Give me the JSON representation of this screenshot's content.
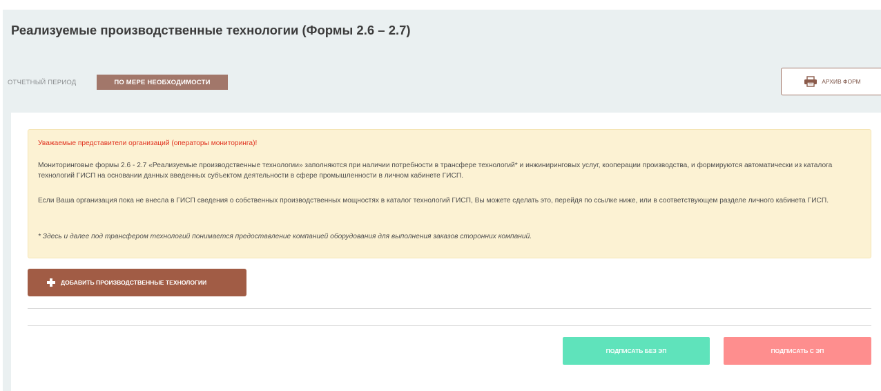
{
  "page": {
    "title": "Реализуемые производственные технологии (Формы 2.6 – 2.7)"
  },
  "period": {
    "label": "ОТЧЕТНЫЙ ПЕРИОД",
    "value": "ПО МЕРЕ НЕОБХОДИМОСТИ"
  },
  "archive_button": {
    "label": "АРХИВ ФОРМ",
    "icon": "printer-icon"
  },
  "notice": {
    "greeting": "Уважаемые представители организаций (операторы мониторинга)!",
    "paragraph1": "Мониторинговые формы 2.6 - 2.7 «Реализуемые производственные технологии» заполняются при наличии потребности в трансфере технологий* и инжиниринговых услуг, кооперации производства, и формируются автоматически из каталога технологий ГИСП на основании данных введенных субъектом деятельности в сфере промышленности в личном кабинете ГИСП.",
    "paragraph2": "Если Ваша организация пока не внесла в ГИСП сведения о собственных производственных мощностях в каталог технологий ГИСП, Вы можете сделать это, перейдя по ссылке ниже, или в соответствующем разделе личного кабинета ГИСП.",
    "footnote": "* Здесь и далее под трансфером технологий понимается предоставление компанией оборудования для выполнения заказов сторонних компаний."
  },
  "add_button": {
    "label": "ДОБАВИТЬ ПРОИЗВОДСТВЕННЫЕ ТЕХНОЛОГИИ",
    "icon": "plus-icon"
  },
  "actions": {
    "sign_without_ep": "ПОДПИСАТЬ БЕЗ ЭП",
    "sign_with_ep": "ПОДПИСАТЬ С ЭП"
  },
  "colors": {
    "accent_brown": "#a15c45",
    "badge": "#a2776a",
    "sign_without_ep": "#5fe3bb",
    "sign_with_ep": "#fe8e8e",
    "notice_background": "#fcf2d3",
    "greeting_text": "#e0321f"
  }
}
